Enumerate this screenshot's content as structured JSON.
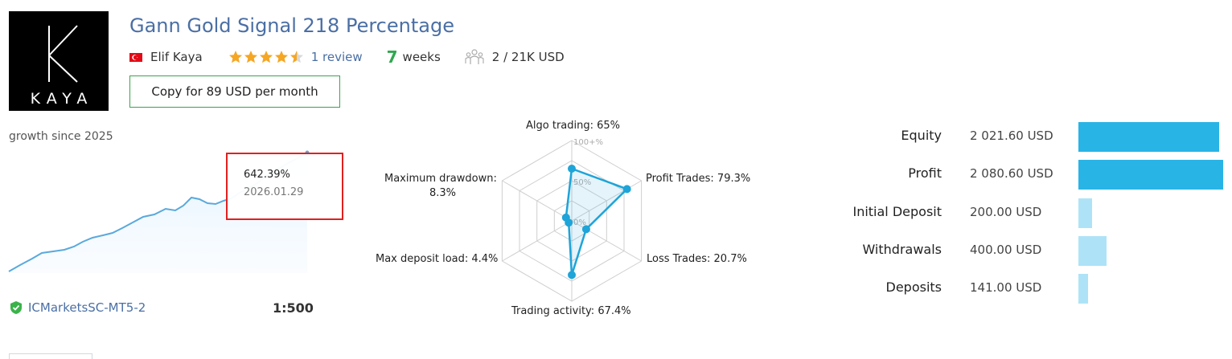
{
  "signal": {
    "title": "Gann Gold Signal 218 Percentage",
    "logo_text": "KAYA",
    "author": "Elif Kaya",
    "rating": 4.5,
    "reviews": "1 review",
    "weeks_value": "7",
    "weeks_label": "weeks",
    "subscribers": "2 / 21K USD",
    "copy_button": "Copy for 89 USD per month"
  },
  "growth": {
    "label": "growth since 2025",
    "tooltip_value": "642.39%",
    "tooltip_date": "2026.01.29",
    "broker": "ICMarketsSC-MT5-2",
    "leverage": "1:500"
  },
  "colors": {
    "title": "#4a6fa5",
    "accent_green": "#2fa84f",
    "line": "#5aa9dc",
    "radar": "#1ea4d8",
    "bar_primary": "#29b4e6",
    "bar_light": "#aee3f7",
    "tooltip_border": "#e02020"
  },
  "radar": {
    "labels": {
      "algo": "Algo trading: 65%",
      "profit": "Profit Trades: 79.3%",
      "loss": "Loss Trades: 20.7%",
      "activity": "Trading activity: 67.4%",
      "deposit_load": "Max deposit load: 4.4%",
      "drawdown_1": "Maximum drawdown:",
      "drawdown_2": "8.3%"
    },
    "ticks": [
      "100+%",
      "50%",
      "0%"
    ]
  },
  "chart_data": [
    {
      "type": "radar",
      "axes": [
        "Algo trading",
        "Profit Trades",
        "Loss Trades",
        "Trading activity",
        "Max deposit load",
        "Maximum drawdown"
      ],
      "values": [
        65,
        79.3,
        20.7,
        67.4,
        4.4,
        8.3
      ]
    },
    {
      "type": "bar",
      "categories": [
        "Equity",
        "Profit",
        "Initial Deposit",
        "Withdrawals",
        "Deposits"
      ],
      "values": [
        2021.6,
        2080.6,
        200.0,
        400.0,
        141.0
      ],
      "value_labels": [
        "2 021.60 USD",
        "2 080.60 USD",
        "200.00 USD",
        "400.00 USD",
        "141.00 USD"
      ]
    }
  ]
}
